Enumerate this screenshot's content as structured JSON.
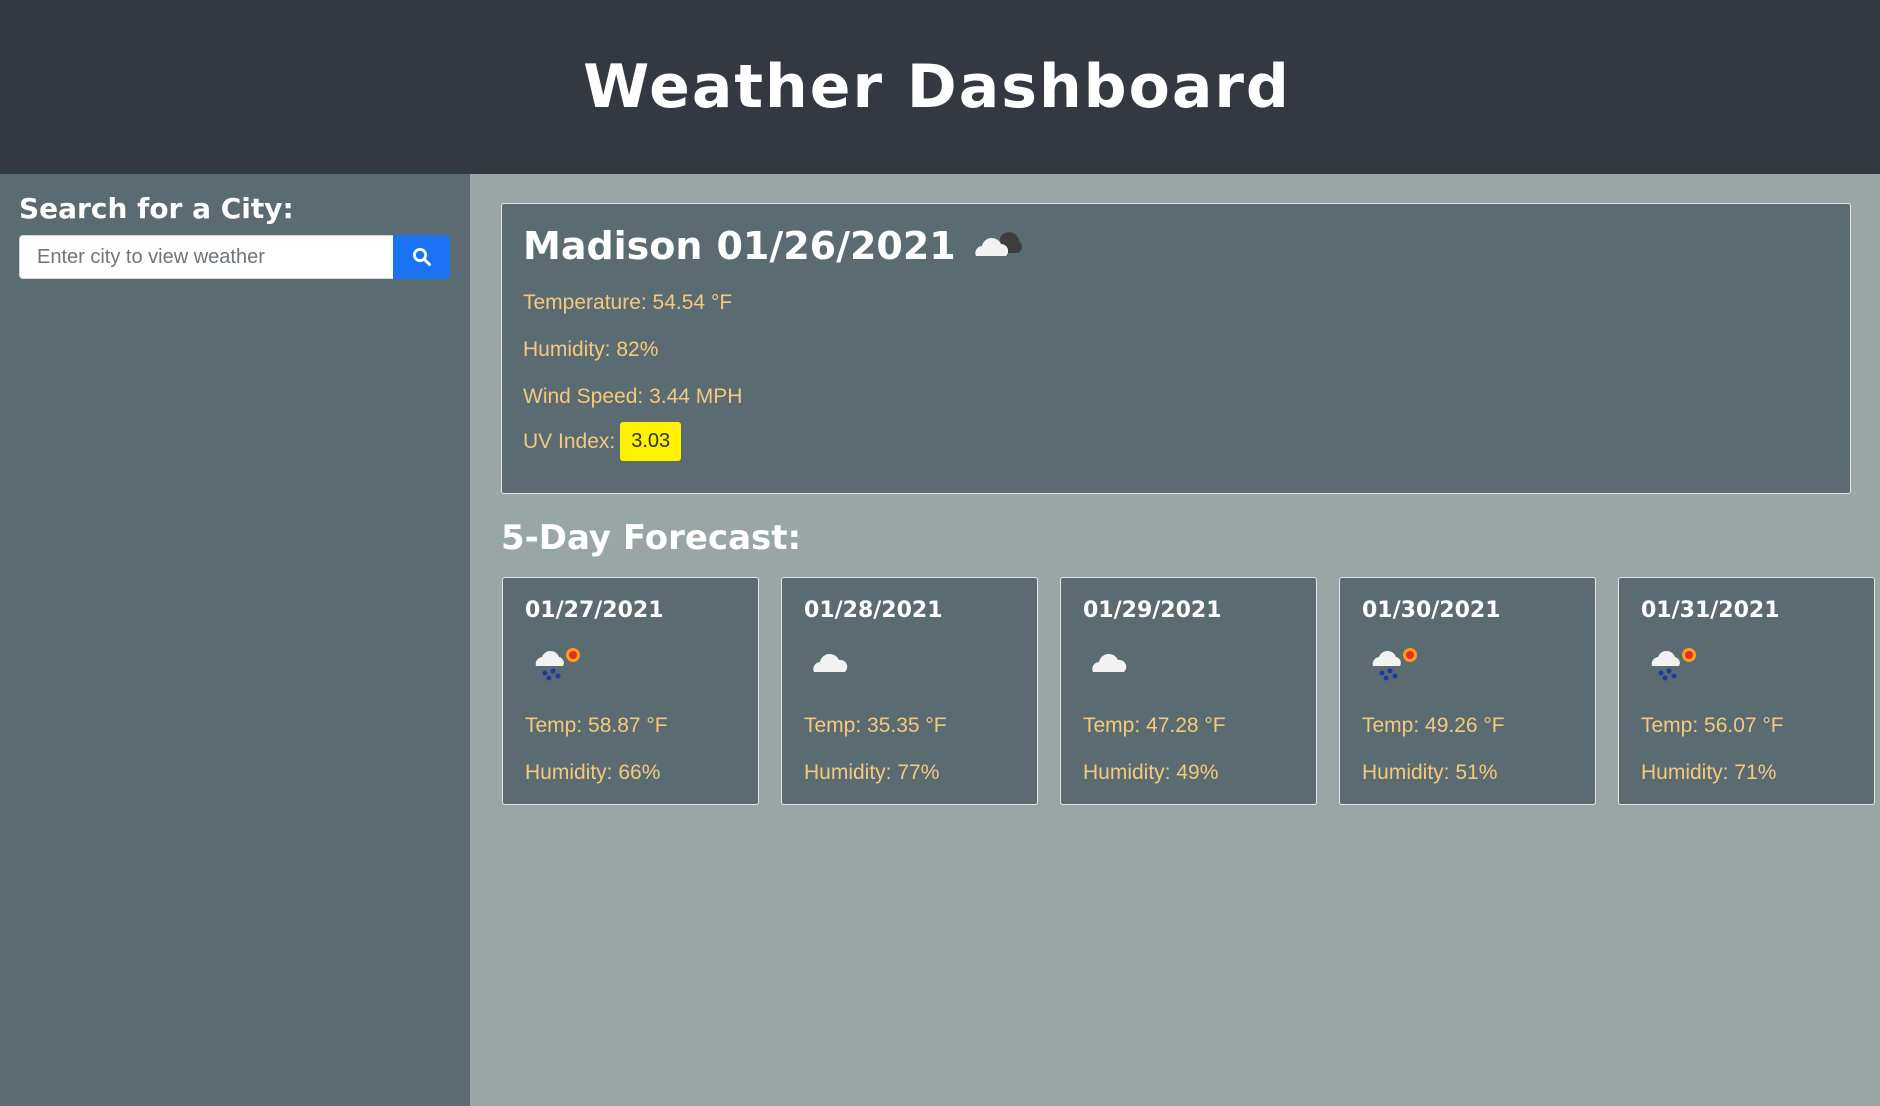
{
  "header": {
    "title": "Weather Dashboard"
  },
  "sidebar": {
    "title": "Search for a City:",
    "search": {
      "placeholder": "Enter city to view weather",
      "value": ""
    },
    "search_button_icon": "search-icon"
  },
  "current": {
    "city": "Madison",
    "date": "01/26/2021",
    "icon": "cloudy-night-icon",
    "temperature": "Temperature: 54.54 °F",
    "humidity": "Humidity: 82%",
    "wind": "Wind Speed: 3.44 MPH",
    "uv_label": "UV Index:",
    "uv_value": "3.03",
    "uv_color": "#fff200"
  },
  "forecast": {
    "title": "5-Day Forecast:",
    "days": [
      {
        "date": "01/27/2021",
        "icon": "rain-sun-icon",
        "temp": "Temp: 58.87 °F",
        "humidity": "Humidity: 66%"
      },
      {
        "date": "01/28/2021",
        "icon": "cloud-icon",
        "temp": "Temp: 35.35 °F",
        "humidity": "Humidity: 77%"
      },
      {
        "date": "01/29/2021",
        "icon": "cloud-icon",
        "temp": "Temp: 47.28 °F",
        "humidity": "Humidity: 49%"
      },
      {
        "date": "01/30/2021",
        "icon": "rain-sun-icon",
        "temp": "Temp: 49.26 °F",
        "humidity": "Humidity: 51%"
      },
      {
        "date": "01/31/2021",
        "icon": "rain-sun-icon",
        "temp": "Temp: 56.07 °F",
        "humidity": "Humidity: 71%"
      }
    ]
  },
  "colors": {
    "header_bg": "#333841",
    "sidebar_bg": "#5b6b72",
    "main_bg": "#99a6a6",
    "accent_text": "#f5c97d",
    "search_button": "#1a73f5"
  }
}
